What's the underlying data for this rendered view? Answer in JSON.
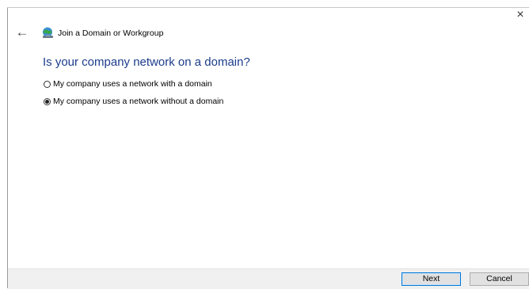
{
  "window": {
    "title": "Join a Domain or Workgroup",
    "close_glyph": "×",
    "back_glyph": "←",
    "title_icon": "network-globe-icon"
  },
  "main": {
    "heading": "Is your company network on a domain?",
    "options": [
      {
        "label": "My company uses a network with a domain",
        "selected": false
      },
      {
        "label": "My company uses a network without a domain",
        "selected": true
      }
    ]
  },
  "footer": {
    "next_label": "Next",
    "cancel_label": "Cancel"
  },
  "colors": {
    "heading": "#1c3c8c",
    "accent": "#0078d7",
    "footer_bg": "#f0f0f0"
  }
}
